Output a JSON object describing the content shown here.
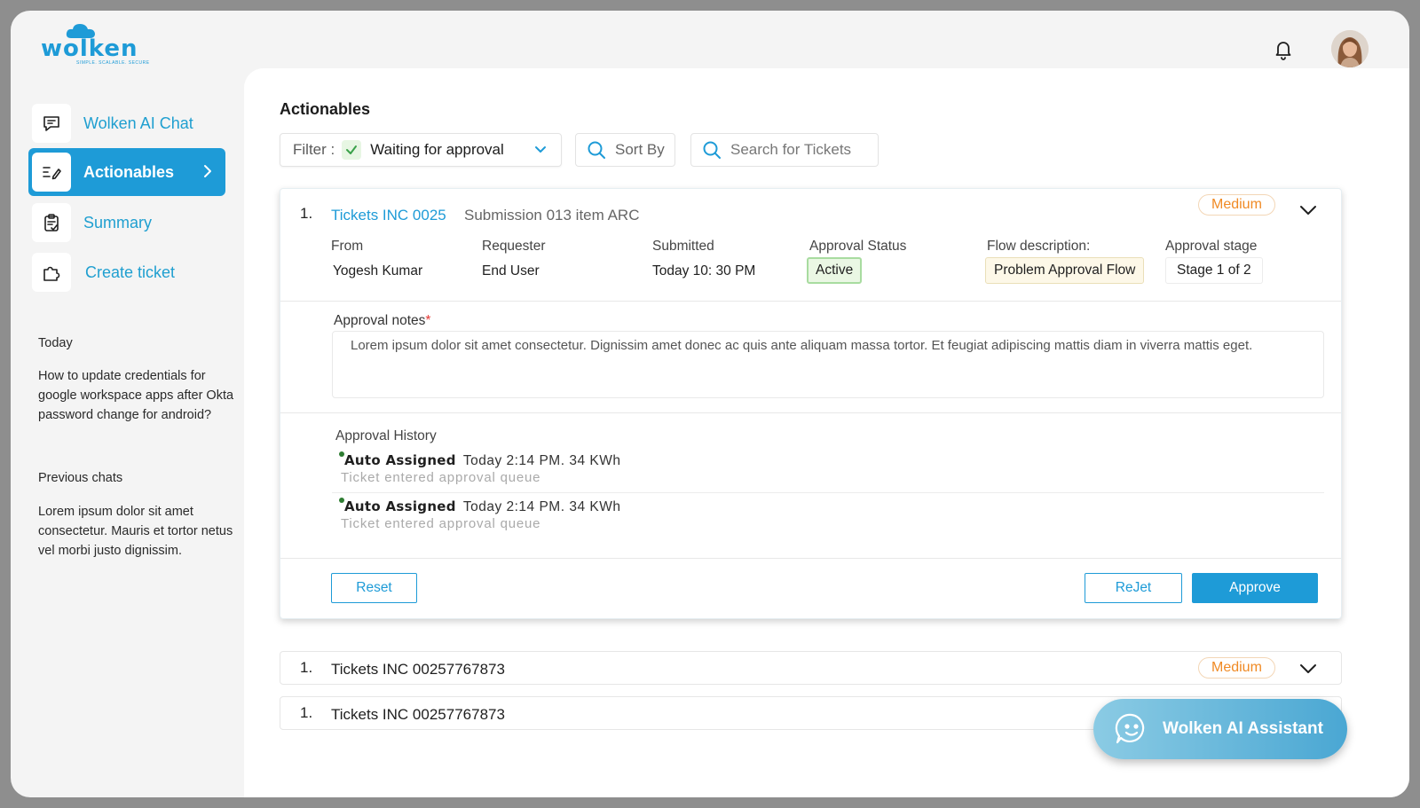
{
  "brand": {
    "name": "wolken",
    "tagline": "SIMPLE. SCALABLE. SECURE",
    "color": "#1e9bd7"
  },
  "header": {
    "notifications_icon": "bell-icon",
    "avatar_icon": "user-avatar"
  },
  "sidebar": {
    "items": [
      {
        "label": "Wolken AI Chat",
        "icon": "chat-icon",
        "active": false
      },
      {
        "label": "Actionables",
        "icon": "task-list-icon",
        "active": true
      },
      {
        "label": "Summary",
        "icon": "clipboard-icon",
        "active": false
      },
      {
        "label": "Create ticket",
        "icon": "puzzle-icon",
        "active": false
      }
    ],
    "today_heading": "Today",
    "today_chat": "How to update credentials for google workspace apps after Okta password change for android?",
    "previous_heading": "Previous chats",
    "previous_chat": "Lorem ipsum dolor sit amet consectetur. Mauris et tortor netus vel morbi justo dignissim."
  },
  "main": {
    "title": "Actionables",
    "filter": {
      "prefix": "Filter :",
      "value": "Waiting for approval"
    },
    "sort_label": "Sort By",
    "search_placeholder": "Search for Tickets",
    "expanded_ticket": {
      "index": "1.",
      "id": "Tickets INC 0025",
      "subtitle": "Submission 013 item ARC",
      "priority": "Medium",
      "fields": {
        "from_label": "From",
        "from_value": "Yogesh Kumar",
        "requester_label": "Requester",
        "requester_value": "End User",
        "submitted_label": "Submitted",
        "submitted_value": "Today 10: 30 PM",
        "status_label": "Approval Status",
        "status_value": "Active",
        "flow_label": "Flow description:",
        "flow_value": "Problem Approval Flow",
        "stage_label": "Approval stage",
        "stage_value": "Stage 1 of 2"
      },
      "notes_label": "Approval notes",
      "notes_required": "*",
      "notes_value": "Lorem ipsum dolor sit amet consectetur. Dignissim amet donec ac quis ante aliquam massa tortor. Et feugiat adipiscing mattis diam in viverra mattis eget.",
      "history_title": "Approval History",
      "history": [
        {
          "who": "Auto Assigned",
          "when": "Today 2:14 PM. 34 KWh",
          "desc": "Ticket entered approval queue"
        },
        {
          "who": "Auto Assigned",
          "when": "Today 2:14 PM. 34 KWh",
          "desc": "Ticket entered approval queue"
        }
      ],
      "reset_label": "Reset",
      "reject_label": "ReJet",
      "approve_label": "Approve"
    },
    "collapsed_tickets": [
      {
        "index": "1.",
        "id": "Tickets INC 00257767873",
        "priority": "Medium"
      },
      {
        "index": "1.",
        "id": "Tickets INC 00257767873",
        "priority": ""
      }
    ]
  },
  "assistant": {
    "label": "Wolken AI Assistant",
    "icon": "smiley-chat-icon"
  }
}
